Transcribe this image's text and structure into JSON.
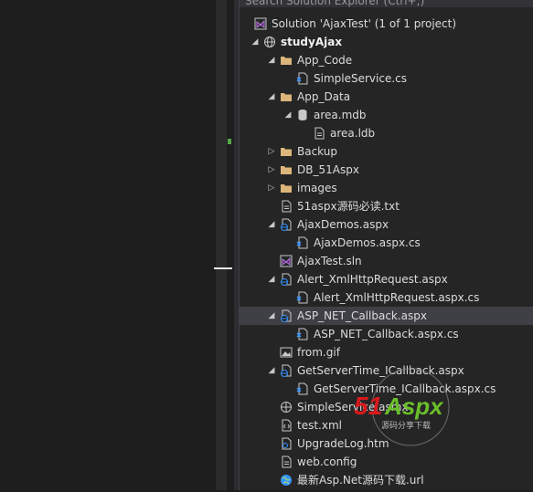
{
  "search": {
    "placeholder": "Search Solution Explorer (Ctrl+;)"
  },
  "tree": [
    {
      "label": "Solution 'AjaxTest' (1 of 1 project)",
      "icon": "solution-icon",
      "depth": 0,
      "chev": ""
    },
    {
      "label": "studyAjax",
      "icon": "web-project-icon",
      "depth": 0,
      "chev": "expanded",
      "bold": true
    },
    {
      "label": "App_Code",
      "icon": "folder-icon",
      "depth": 1,
      "chev": "expanded"
    },
    {
      "label": "SimpleService.cs",
      "icon": "cs-file-icon",
      "depth": 2,
      "chev": ""
    },
    {
      "label": "App_Data",
      "icon": "folder-icon",
      "depth": 1,
      "chev": "expanded"
    },
    {
      "label": "area.mdb",
      "icon": "database-icon",
      "depth": 2,
      "chev": "expanded"
    },
    {
      "label": "area.ldb",
      "icon": "file-icon",
      "depth": 3,
      "chev": ""
    },
    {
      "label": "Backup",
      "icon": "folder-icon",
      "depth": 1,
      "chev": "collapsed"
    },
    {
      "label": "DB_51Aspx",
      "icon": "folder-icon",
      "depth": 1,
      "chev": "collapsed"
    },
    {
      "label": "images",
      "icon": "folder-icon",
      "depth": 1,
      "chev": "collapsed"
    },
    {
      "label": "51aspx源码必读.txt",
      "icon": "text-file-icon",
      "depth": 1,
      "chev": ""
    },
    {
      "label": "AjaxDemos.aspx",
      "icon": "aspx-page-icon",
      "depth": 1,
      "chev": "expanded"
    },
    {
      "label": "AjaxDemos.aspx.cs",
      "icon": "cs-file-icon",
      "depth": 2,
      "chev": ""
    },
    {
      "label": "AjaxTest.sln",
      "icon": "solution-icon",
      "depth": 1,
      "chev": ""
    },
    {
      "label": "Alert_XmlHttpRequest.aspx",
      "icon": "aspx-page-icon",
      "depth": 1,
      "chev": "expanded"
    },
    {
      "label": "Alert_XmlHttpRequest.aspx.cs",
      "icon": "cs-file-icon",
      "depth": 2,
      "chev": ""
    },
    {
      "label": "ASP_NET_Callback.aspx",
      "icon": "aspx-page-icon",
      "depth": 1,
      "chev": "expanded",
      "selected": true
    },
    {
      "label": "ASP_NET_Callback.aspx.cs",
      "icon": "cs-file-icon",
      "depth": 2,
      "chev": ""
    },
    {
      "label": "from.gif",
      "icon": "image-file-icon",
      "depth": 1,
      "chev": ""
    },
    {
      "label": "GetServerTime_ICallback.aspx",
      "icon": "aspx-page-icon",
      "depth": 1,
      "chev": "expanded"
    },
    {
      "label": "GetServerTime_ICallback.aspx.cs",
      "icon": "cs-file-icon",
      "depth": 2,
      "chev": ""
    },
    {
      "label": "SimpleService.asmx",
      "icon": "web-service-icon",
      "depth": 1,
      "chev": ""
    },
    {
      "label": "test.xml",
      "icon": "xml-file-icon",
      "depth": 1,
      "chev": ""
    },
    {
      "label": "UpgradeLog.htm",
      "icon": "html-file-icon",
      "depth": 1,
      "chev": ""
    },
    {
      "label": "web.config",
      "icon": "config-file-icon",
      "depth": 1,
      "chev": ""
    },
    {
      "label": "最新Asp.Net源码下载.url",
      "icon": "url-globe-icon",
      "depth": 1,
      "chev": ""
    }
  ],
  "watermark": {
    "brand": "51Aspx",
    "tagline": "源码分享下载"
  },
  "colors": {
    "folder": "#dcb67a",
    "accent": "#68217a",
    "selection": "#3f3f46",
    "watermark_red": "#d7191c",
    "watermark_green": "#6abf2a"
  }
}
